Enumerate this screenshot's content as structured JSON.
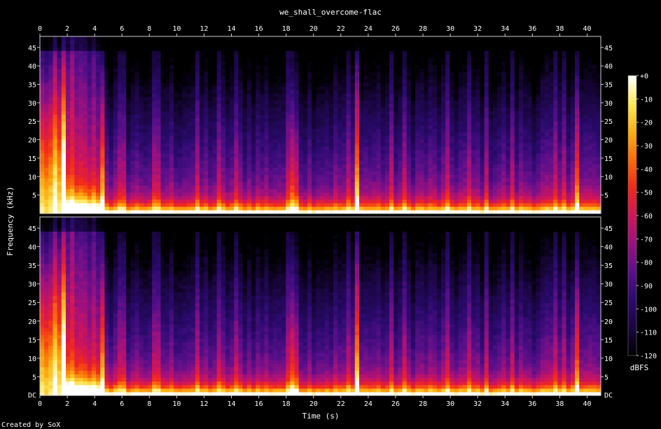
{
  "chart_data": {
    "type": "heatmap",
    "subtype": "spectrogram",
    "title": "we_shall_overcome-flac",
    "xlabel": "Time (s)",
    "ylabel": "Frequency (kHz)",
    "xlim": [
      0,
      41
    ],
    "ylim": [
      0,
      48
    ],
    "x_ticks": [
      0,
      2,
      4,
      6,
      8,
      10,
      12,
      14,
      16,
      18,
      20,
      22,
      24,
      26,
      28,
      30,
      32,
      34,
      36,
      38,
      40
    ],
    "y_ticks": [
      5,
      10,
      15,
      20,
      25,
      30,
      35,
      40,
      45
    ],
    "y_zero_label": "DC",
    "channels": 2,
    "colorbar": {
      "label": "dBFS",
      "range": [
        -120,
        0
      ],
      "ticks": [
        "+0",
        "-10",
        "-20",
        "-30",
        "-40",
        "-50",
        "-60",
        "-70",
        "-80",
        "-90",
        "-100",
        "-110",
        "-120"
      ]
    },
    "colormap": [
      "#000000",
      "#1a0640",
      "#2b0a6e",
      "#5a0f8a",
      "#9a1180",
      "#d0155a",
      "#f0281e",
      "#fa6a0a",
      "#fcb014",
      "#fde85a",
      "#ffffff"
    ],
    "broadband_onsets_s": [
      1.8,
      4.6,
      18.6,
      23.2,
      39.2
    ],
    "background": "#000000"
  },
  "footer": {
    "credit": "Created by SoX"
  }
}
